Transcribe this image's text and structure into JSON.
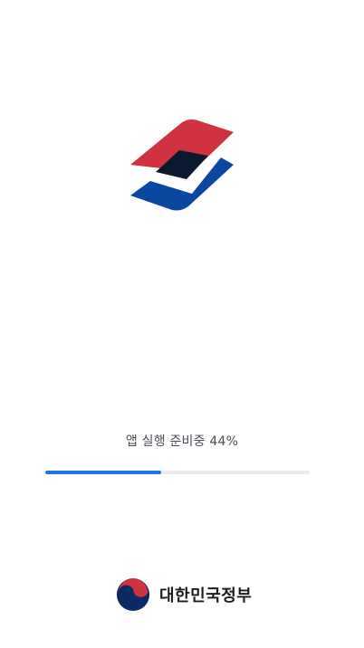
{
  "splash": {
    "logo_icon": "app-logo-icon",
    "brand_colors": {
      "red": "#d0323f",
      "navy": "#0a1a2e",
      "blue": "#0a47a0"
    }
  },
  "loading": {
    "status_text": "앱 실행 준비중 44%",
    "progress": 0.44,
    "track_color": "#ebecee",
    "fill_color": "#1a73e8"
  },
  "footer": {
    "emblem_icon": "government-emblem-icon",
    "government_name": "대한민국정부"
  }
}
